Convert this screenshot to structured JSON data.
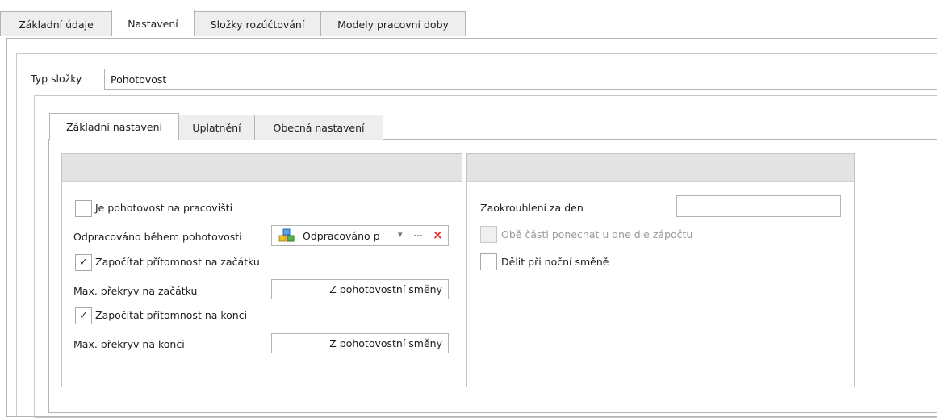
{
  "top_tabs": [
    {
      "label": "Základní údaje"
    },
    {
      "label": "Nastavení",
      "active": true
    },
    {
      "label": "Složky rozúčtování"
    },
    {
      "label": "Modely pracovní doby"
    }
  ],
  "typ_slozky": {
    "label": "Typ složky",
    "value": "Pohotovost"
  },
  "inner_tabs": [
    {
      "label": "Základní nastavení",
      "active": true
    },
    {
      "label": "Uplatnění"
    },
    {
      "label": "Obecná nastavení"
    }
  ],
  "left_panel": {
    "je_pohotovost": {
      "label": "Je pohotovost na pracovišti",
      "checked": false
    },
    "odpracovano": {
      "label": "Odpracováno během pohotovosti",
      "value": "Odpracováno p",
      "icon": "component-cubes-icon",
      "dropdown_glyph": "▾",
      "ellipsis_glyph": "···",
      "clear_glyph": "×"
    },
    "zapocitat_zacatek": {
      "label": "Započítat přítomnost na začátku",
      "checked": true,
      "check_glyph": "✓"
    },
    "max_prekryv_zacatek": {
      "label": "Max. překryv na začátku",
      "value": "Z pohotovostní směny"
    },
    "zapocitat_konec": {
      "label": "Započítat přítomnost na konci",
      "checked": true,
      "check_glyph": "✓"
    },
    "max_prekryv_konec": {
      "label": "Max. překryv na konci",
      "value": "Z pohotovostní směny"
    }
  },
  "right_panel": {
    "zaokrouhleni": {
      "label": "Zaokrouhlení za den",
      "value": ""
    },
    "obe_casti": {
      "label": "Obě části ponechat u dne dle zápočtu",
      "checked": false,
      "disabled": true
    },
    "delit": {
      "label": "Dělit při noční směně",
      "checked": false
    }
  },
  "colors": {
    "clear_red": "#e03131",
    "tab_inactive": "#eeeeee",
    "panel_header": "#e3e3e3",
    "border": "#b4b4b4"
  }
}
